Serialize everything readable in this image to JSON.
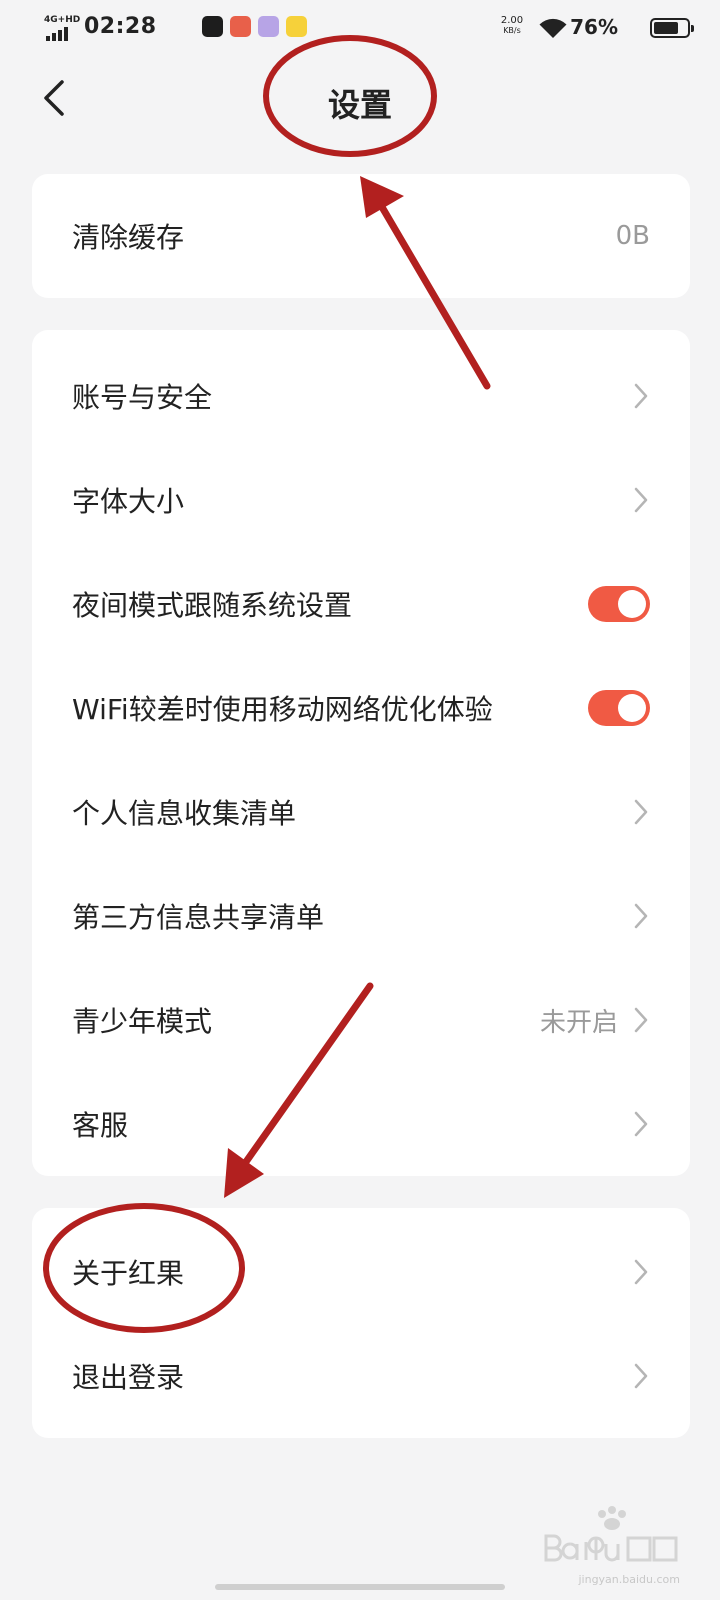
{
  "status_bar": {
    "network": "4G+HD",
    "time": "02:28",
    "net_speed": "2.00",
    "net_speed_unit": "KB/s",
    "battery_percent": "76%",
    "battery_level": 0.76,
    "icons": [
      "signal-icon",
      "wifi-icon",
      "battery-icon"
    ]
  },
  "header": {
    "back_icon": "chevron-left-icon",
    "title": "设置"
  },
  "cache_card": {
    "label": "清除缓存",
    "value": "0B"
  },
  "main_card": {
    "items": [
      {
        "label": "账号与安全",
        "control": "chevron"
      },
      {
        "label": "字体大小",
        "control": "chevron"
      },
      {
        "label": "夜间模式跟随系统设置",
        "control": "toggle",
        "on": true
      },
      {
        "label": "WiFi较差时使用移动网络优化体验",
        "control": "toggle",
        "on": true
      },
      {
        "label": "个人信息收集清单",
        "control": "chevron"
      },
      {
        "label": "第三方信息共享清单",
        "control": "chevron"
      },
      {
        "label": "青少年模式",
        "value": "未开启",
        "control": "chevron"
      },
      {
        "label": "客服",
        "control": "chevron"
      }
    ]
  },
  "bottom_card": {
    "items": [
      {
        "label": "关于红果",
        "control": "chevron"
      },
      {
        "label": "退出登录",
        "control": "chevron"
      }
    ]
  },
  "colors": {
    "background": "#f4f4f5",
    "card": "#ffffff",
    "toggle_on": "#f05a44",
    "annotation": "#b2201f",
    "secondary_text": "#9a9a9a"
  },
  "watermark": {
    "text": "jingyan.baidu.com"
  }
}
